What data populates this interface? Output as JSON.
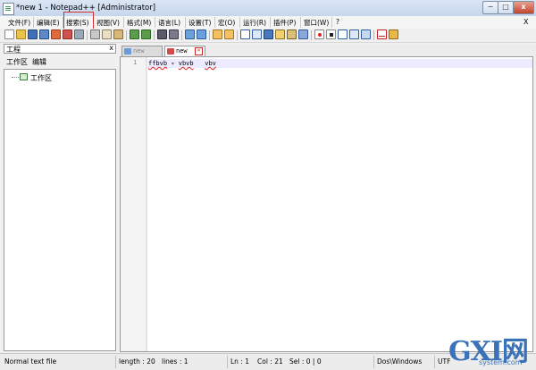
{
  "window": {
    "title": "*new  1 - Notepad++ [Administrator]",
    "controls": {
      "minimize": "−",
      "maximize": "□",
      "close": "x"
    }
  },
  "menubar": {
    "items": [
      "文件(F)",
      "编辑(E)",
      "搜索(S)",
      "视图(V)",
      "格式(M)",
      "语言(L)",
      "设置(T)",
      "宏(O)",
      "运行(R)",
      "插件(P)",
      "窗口(W)",
      "?"
    ],
    "highlighted": "搜索(S)",
    "highlight_color": "#d42f2f",
    "close_doc": "X"
  },
  "toolbar": {
    "icons": [
      "new-file-icon",
      "open-file-icon",
      "save-icon",
      "save-all-icon",
      "close-icon",
      "close-all-icon",
      "print-icon",
      "cut-icon",
      "copy-icon",
      "paste-icon",
      "undo-icon",
      "redo-icon",
      "find-icon",
      "replace-icon",
      "zoom-in-icon",
      "zoom-out-icon",
      "sync-v-icon",
      "sync-h-icon",
      "word-wrap-icon",
      "show-all-chars-icon",
      "indent-guide-icon",
      "doc-map-icon",
      "function-list-icon",
      "folder-workspace-icon",
      "record-macro-icon",
      "stop-macro-icon",
      "play-macro-icon",
      "run-macro-multiple-icon",
      "save-macro-icon",
      "spellcheck-icon",
      "plugin-icon"
    ]
  },
  "panel": {
    "title": "工程",
    "close_label": "x",
    "menu": [
      "工作区",
      "编辑"
    ],
    "tree_root": "工作区"
  },
  "tabs": [
    {
      "label": "new",
      "active": false,
      "icon_color": "#6c9ad8"
    },
    {
      "label": "new",
      "active": true,
      "icon_color": "#d24a4a"
    }
  ],
  "editor": {
    "line_number": "1",
    "tokens": [
      {
        "text": "ffbvb",
        "misspelled": true
      },
      {
        "text": " ▿ ",
        "misspelled": false
      },
      {
        "text": "vbvb",
        "misspelled": true
      },
      {
        "text": "   ",
        "misspelled": false
      },
      {
        "text": "vbv",
        "misspelled": true
      }
    ]
  },
  "statusbar": {
    "file_type": "Normal text file",
    "length": "length : 20",
    "lines": "lines : 1",
    "ln": "Ln : 1",
    "col": "Col : 21",
    "sel": "Sel : 0 | 0",
    "eol": "Dos\\Windows",
    "encoding": "UTF"
  },
  "watermark": {
    "big": "GXI网",
    "small": "system.com"
  }
}
